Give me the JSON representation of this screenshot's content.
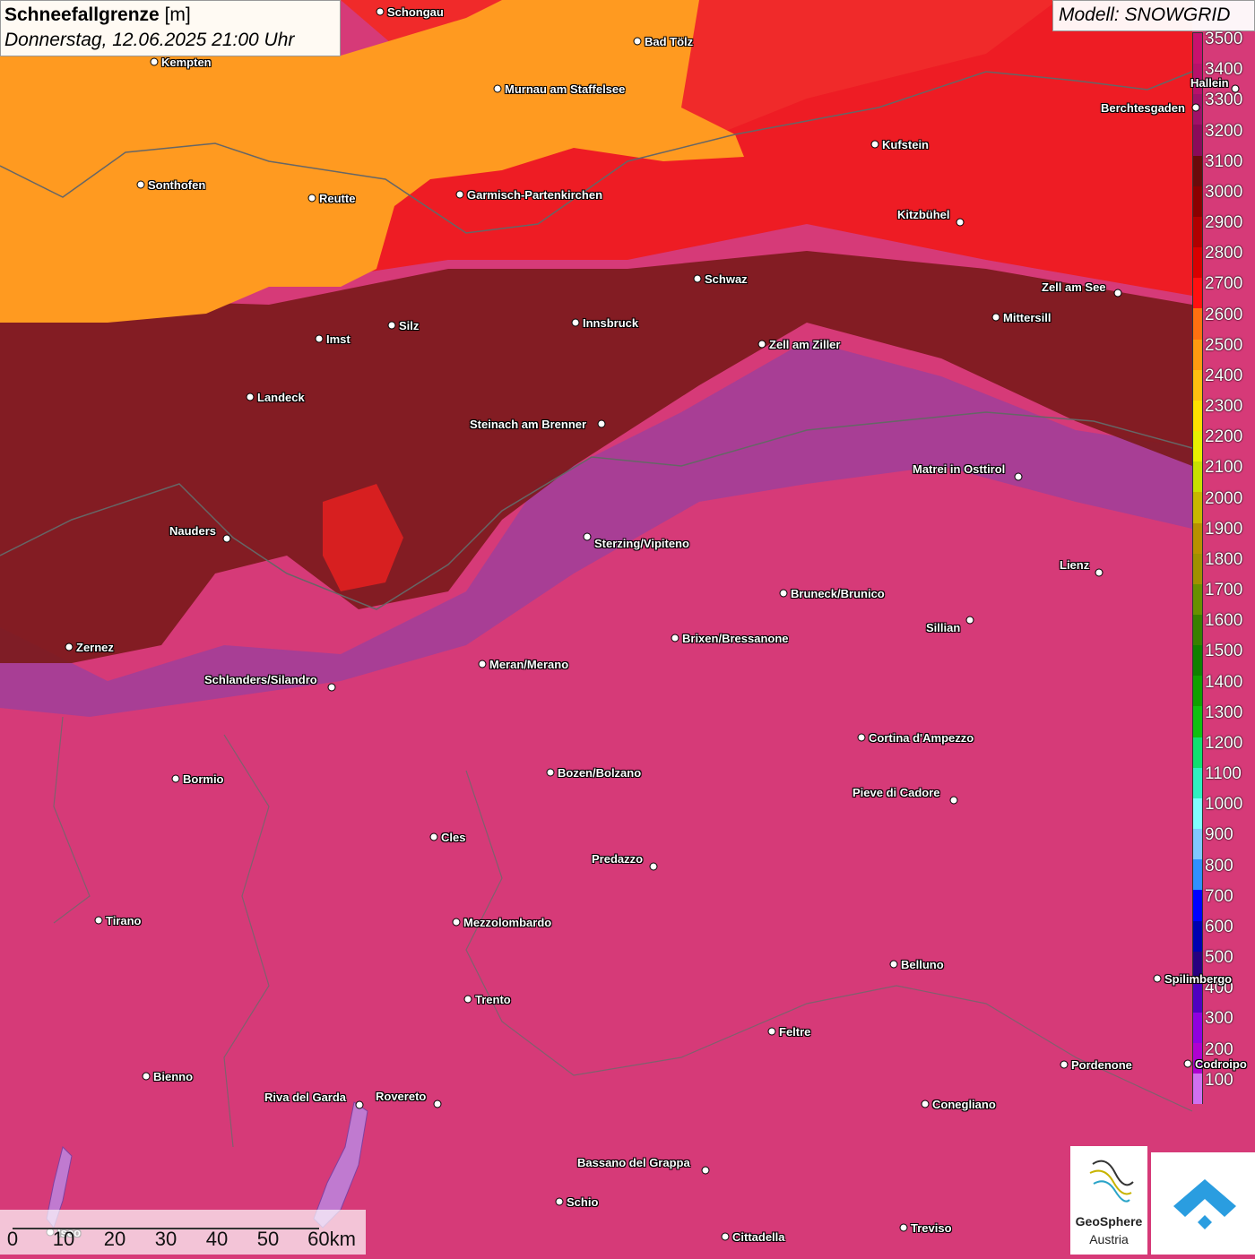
{
  "title": {
    "name": "Schneefallgrenze",
    "unit": "[m]",
    "datetime": "Donnerstag, 12.06.2025 21:00 Uhr"
  },
  "model": "Modell: SNOWGRID",
  "legend": {
    "labels": [
      "3500",
      "3400",
      "3300",
      "3200",
      "3100",
      "3000",
      "2900",
      "2800",
      "2700",
      "2600",
      "2500",
      "2400",
      "2300",
      "2200",
      "2100",
      "2000",
      "1900",
      "1800",
      "1700",
      "1600",
      "1500",
      "1400",
      "1300",
      "1200",
      "1100",
      "1000",
      "900",
      "800",
      "700",
      "600",
      "500",
      "400",
      "300",
      "200",
      "100"
    ],
    "colors": [
      "#c8106e",
      "#b8106a",
      "#a01068",
      "#8a0a5a",
      "#6a0a0a",
      "#8a0000",
      "#b00000",
      "#d80000",
      "#ff1010",
      "#ff7010",
      "#ff9a10",
      "#ffbe10",
      "#ffe000",
      "#e8f000",
      "#c8e000",
      "#c8b800",
      "#b89000",
      "#a09000",
      "#689000",
      "#388000",
      "#108000",
      "#10a000",
      "#10c010",
      "#10e070",
      "#30f0c0",
      "#80ffff",
      "#80c8ff",
      "#3090ff",
      "#0000ff",
      "#0000b0",
      "#280080",
      "#5000c0",
      "#9000e0",
      "#b000d0",
      "#d070f0"
    ]
  },
  "cities": [
    {
      "name": "Schongau"
    },
    {
      "name": "Bad Tölz"
    },
    {
      "name": "Kempten"
    },
    {
      "name": "Murnau am Staffelsee"
    },
    {
      "name": "Hallein"
    },
    {
      "name": "Berchtesgaden"
    },
    {
      "name": "Kufstein"
    },
    {
      "name": "Sonthofen"
    },
    {
      "name": "Reutte"
    },
    {
      "name": "Garmisch-Partenkirchen"
    },
    {
      "name": "Kitzbühel"
    },
    {
      "name": "Schwaz"
    },
    {
      "name": "Zell am See"
    },
    {
      "name": "Innsbruck"
    },
    {
      "name": "Mittersill"
    },
    {
      "name": "Imst"
    },
    {
      "name": "Silz"
    },
    {
      "name": "Zell am Ziller"
    },
    {
      "name": "Landeck"
    },
    {
      "name": "Steinach am Brenner"
    },
    {
      "name": "Matrei in Osttirol"
    },
    {
      "name": "Nauders"
    },
    {
      "name": "Sterzing/Vipiteno"
    },
    {
      "name": "Lienz"
    },
    {
      "name": "Bruneck/Brunico"
    },
    {
      "name": "Sillian"
    },
    {
      "name": "Zernez"
    },
    {
      "name": "Brixen/Bressanone"
    },
    {
      "name": "Meran/Merano"
    },
    {
      "name": "Schlanders/Silandro"
    },
    {
      "name": "Cortina d'Ampezzo"
    },
    {
      "name": "Bormio"
    },
    {
      "name": "Bozen/Bolzano"
    },
    {
      "name": "Pieve di Cadore"
    },
    {
      "name": "Cles"
    },
    {
      "name": "Predazzo"
    },
    {
      "name": "Tirano"
    },
    {
      "name": "Mezzolombardo"
    },
    {
      "name": "Belluno"
    },
    {
      "name": "Spilimbergo"
    },
    {
      "name": "Trento"
    },
    {
      "name": "Feltre"
    },
    {
      "name": "Pordenone"
    },
    {
      "name": "Codroipo"
    },
    {
      "name": "Bienno"
    },
    {
      "name": "Riva del Garda"
    },
    {
      "name": "Rovereto"
    },
    {
      "name": "Conegliano"
    },
    {
      "name": "Bassano del Grappa"
    },
    {
      "name": "Schio"
    },
    {
      "name": "Treviso"
    },
    {
      "name": "Cittadella"
    },
    {
      "name": "Iseo"
    }
  ],
  "scale": {
    "labels": [
      "0",
      "10",
      "20",
      "30",
      "40",
      "50",
      "60km"
    ]
  },
  "logo": {
    "line1": "GeoSphere",
    "line2": "Austria"
  }
}
